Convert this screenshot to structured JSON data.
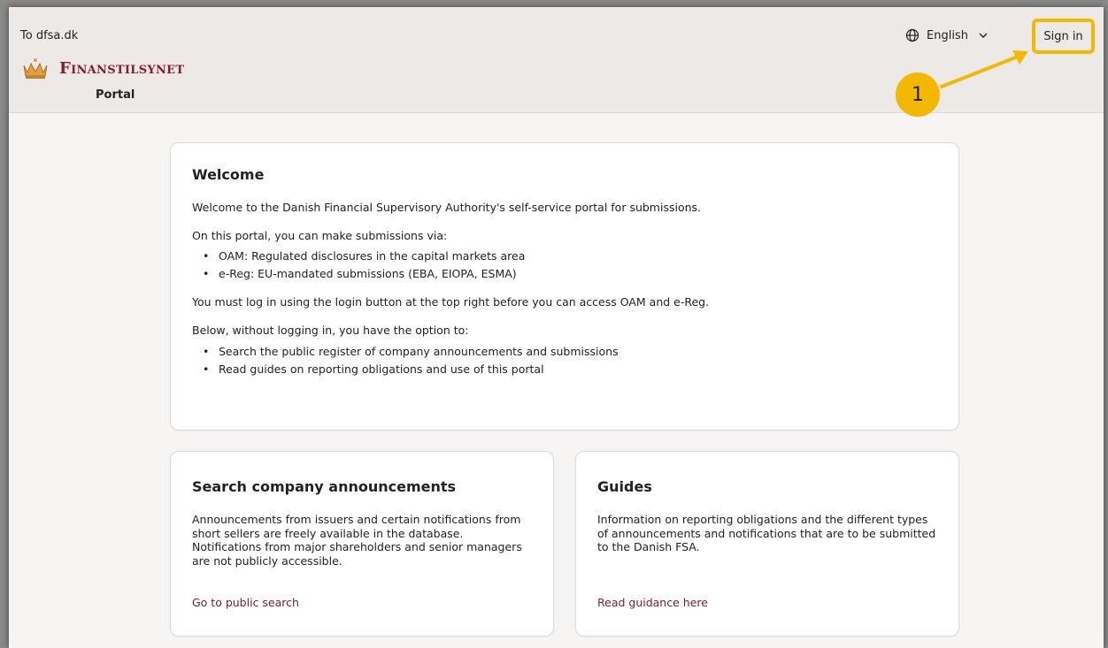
{
  "header": {
    "back_link": "To dfsa.dk",
    "logo_text": "Finanstilsynet",
    "portal_label": "Portal",
    "language": "English",
    "sign_in": "Sign in",
    "callout_number": "1",
    "brand_color": "#8b1a2b",
    "highlight_color": "#f5b800"
  },
  "welcome": {
    "title": "Welcome",
    "intro": "Welcome to the Danish Financial Supervisory Authority's self-service portal for submissions.",
    "submissions_intro": "On this portal, you can make submissions via:",
    "submissions": [
      "OAM: Regulated disclosures in the capital markets area",
      "e-Reg: EU-mandated submissions (EBA, EIOPA, ESMA)"
    ],
    "login_note": "You must log in using the login button at the top right before you can access OAM and e-Reg.",
    "options_intro": "Below, without logging in, you have the option to:",
    "options": [
      "Search the public register of company announcements and submissions",
      "Read guides on reporting obligations and use of this portal"
    ]
  },
  "search_card": {
    "title": "Search company announcements",
    "body": "Announcements from issuers and certain notifications from short sellers are freely available in the database. Notifications from major shareholders and senior managers are not publicly accessible.",
    "link": "Go to public search"
  },
  "guides_card": {
    "title": "Guides",
    "body": "Information on reporting obligations and the different types of announcements and notifications that are to be submitted to the Danish FSA.",
    "link": "Read guidance here"
  }
}
